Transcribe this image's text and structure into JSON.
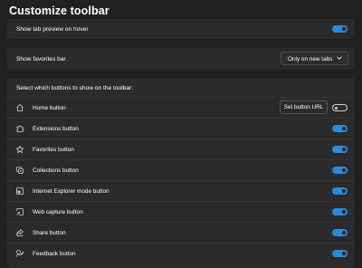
{
  "page": {
    "title": "Customize toolbar"
  },
  "tab_preview": {
    "label": "Show tab preview on hover",
    "enabled": true
  },
  "favorites_bar": {
    "label": "Show favorites bar",
    "selected": "Only on new tabs"
  },
  "toolbar_buttons": {
    "header": "Select which buttons to show on the toolbar:",
    "set_url_label": "Set button URL",
    "items": [
      {
        "label": "Home button",
        "icon": "home-icon",
        "enabled": false
      },
      {
        "label": "Extensions button",
        "icon": "puzzle-icon",
        "enabled": true
      },
      {
        "label": "Favorites button",
        "icon": "star-icon",
        "enabled": true
      },
      {
        "label": "Collections button",
        "icon": "collections-icon",
        "enabled": true
      },
      {
        "label": "Internet Explorer mode button",
        "icon": "ie-mode-icon",
        "enabled": true
      },
      {
        "label": "Web capture button",
        "icon": "web-capture-icon",
        "enabled": true
      },
      {
        "label": "Share button",
        "icon": "share-icon",
        "enabled": true
      },
      {
        "label": "Feedback button",
        "icon": "feedback-icon",
        "enabled": true
      }
    ]
  },
  "colors": {
    "accent": "#2b8bd9",
    "background": "#202020",
    "card": "#2b2b2b"
  }
}
